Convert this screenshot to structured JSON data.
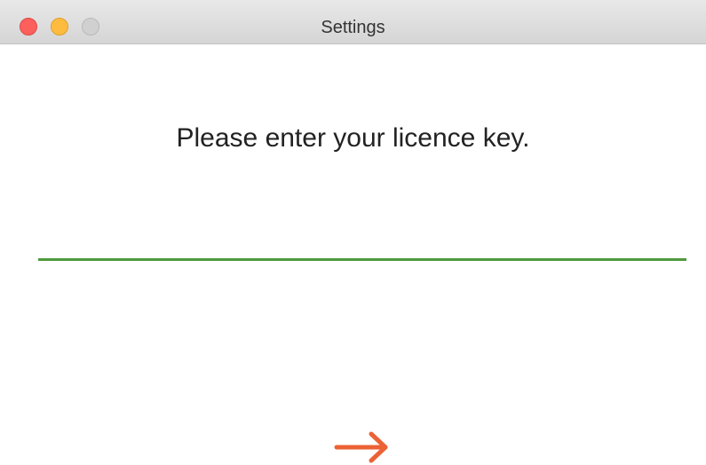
{
  "window": {
    "title": "Settings"
  },
  "content": {
    "prompt": "Please enter your licence key.",
    "licence_input": {
      "value": "",
      "placeholder": ""
    },
    "next_button": {
      "icon": "arrow-right-icon"
    }
  },
  "colors": {
    "input_underline": "#4e9a3c",
    "arrow": "#ec6235",
    "close": "#fc605c",
    "minimize": "#fdbc40",
    "zoom": "#d1d0d1"
  }
}
